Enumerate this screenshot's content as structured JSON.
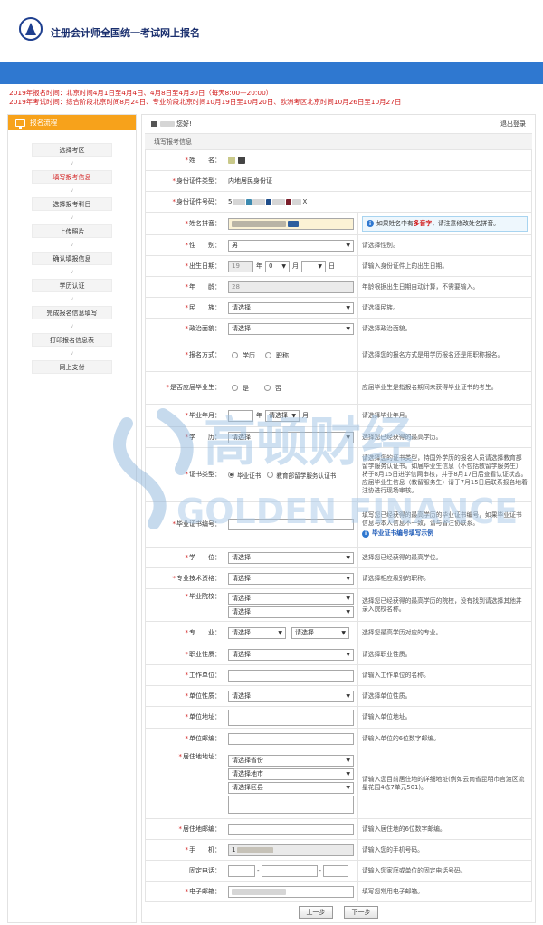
{
  "header": {
    "title": "注册会计师全国统一考试网上报名"
  },
  "notice": {
    "line1": "2019年报名时间：北京时间4月1日至4月4日、4月8日至4月30日（每天8:00—20:00）",
    "line2": "2019年考试时间：综合阶段北京时间8月24日、专业阶段北京时间10月19日至10月20日、欧洲考区北京时间10月26日至10月27日"
  },
  "sidebar": {
    "title": "报名流程",
    "steps": [
      {
        "label": "选择考区"
      },
      {
        "label": "填写报考信息"
      },
      {
        "label": "选择报考科目"
      },
      {
        "label": "上传照片"
      },
      {
        "label": "确认填报信息"
      },
      {
        "label": "学历认证"
      },
      {
        "label": "完成报名信息填写"
      },
      {
        "label": "打印报名信息表"
      },
      {
        "label": "网上支付"
      }
    ]
  },
  "main": {
    "greeting": "您好!",
    "logout": "退出登录",
    "section_title": "填写报考信息"
  },
  "form": {
    "name": {
      "label": "姓　　名："
    },
    "id_type": {
      "label": "身份证件类型：",
      "value": "内地居民身份证"
    },
    "id_number": {
      "label": "身份证件号码：",
      "prefix": "5",
      "suffix": "X"
    },
    "pinyin": {
      "label": "姓名拼音：",
      "hint_prefix": "如果姓名中有",
      "hint_red": "多音字",
      "hint_suffix": "，请注意修改姓名拼音。"
    },
    "gender": {
      "label": "性　　别：",
      "value": "男",
      "tip": "请选择性别。"
    },
    "birth": {
      "label": "出生日期：",
      "year_prefix": "19",
      "year_unit": "年",
      "month_value": "0",
      "month_unit": "月",
      "day_unit": "日",
      "tip": "请输入身份证件上的出生日期。"
    },
    "age": {
      "label": "年　　龄：",
      "value": "28",
      "tip": "年龄根据出生日期自动计算，不需要输入。"
    },
    "ethnic": {
      "label": "民　　族：",
      "value": "请选择",
      "tip": "请选择民族。"
    },
    "political": {
      "label": "政治面貌：",
      "value": "请选择",
      "tip": "请选择政治面貌。"
    },
    "apply_method": {
      "label": "报名方式：",
      "opt1": "学历",
      "opt2": "职称",
      "tip": "请选择您的报名方式是用学历报名还是用职称报名。"
    },
    "fresh_grad": {
      "label": "是否应届毕业生：",
      "opt1": "是",
      "opt2": "否",
      "tip": "应届毕业生是指报名期间未获得毕业证书的考生。"
    },
    "grad_year": {
      "label": "毕业年月：",
      "year_unit": "年",
      "month_value": "请选择",
      "month_unit": "月",
      "tip": "请选择毕业年月。"
    },
    "education": {
      "label": "学　　历：",
      "value": "请选择",
      "tip": "选择您已经获得的最高学历。"
    },
    "cert_type": {
      "label": "证书类型：",
      "opt1": "毕业证书",
      "opt2": "教育部留学服务认证书",
      "tip": "请选择您的证书类型，持国外学历的报名人员请选择教育部留学服务认证书。如届毕业生信息（不包括教留学服务生）将于8月15日进学信网审核，并于8月17日后查看认证状态。应届毕业生信息（教留服务生）请于7月15日后联系报名地着注协进行现场审核。"
    },
    "cert_no": {
      "label": "毕业证书编号：",
      "tip": "填写您已经获得的最高学历的毕业证书编号，如果毕业证书信息与本人信息不一致，请与省注协联系。",
      "link": "毕业证书编号填写示例"
    },
    "degree": {
      "label": "学　　位：",
      "value": "请选择",
      "tip": "选择您已经获得的最高学位。"
    },
    "title": {
      "label": "专业技术资格：",
      "value": "请选择",
      "tip": "请选择相应级别的职称。"
    },
    "school": {
      "label": "毕业院校：",
      "value1": "请选择",
      "value2": "请选择",
      "tip": "选择您已经获得的最高学历的院校，没有找到请选择其他并录入院校名称。"
    },
    "major": {
      "label": "专　　业：",
      "value1": "请选择",
      "value2": "请选择",
      "tip": "选择您最高学历对应的专业。"
    },
    "job_type": {
      "label": "职业性质：",
      "value": "请选择",
      "tip": "请选择职业性质。"
    },
    "employer": {
      "label": "工作单位：",
      "tip": "请输入工作单位的名称。"
    },
    "employer_type": {
      "label": "单位性质：",
      "value": "请选择",
      "tip": "请选择单位性质。"
    },
    "employer_addr": {
      "label": "单位地址：",
      "tip": "请输入单位地址。"
    },
    "employer_zip": {
      "label": "单位邮编：",
      "tip": "请输入单位的6位数字邮编。"
    },
    "home_addr": {
      "label": "居住地地址：",
      "province": "请选择省份",
      "city": "请选择地市",
      "county": "请选择区县",
      "tip": "请输入您目前居住地的详细地址(例如云南省昆明市官渡区流星花园4栋7单元501)。"
    },
    "home_zip": {
      "label": "居住地邮编：",
      "tip": "请输入居住地的6位数字邮编。"
    },
    "mobile": {
      "label": "手　　机：",
      "prefix": "1",
      "tip": "请输入您的手机号码。"
    },
    "phone": {
      "label": "固定电话：",
      "sep": "-",
      "tip": "请输入您家庭或单位的固定电话号码。"
    },
    "email": {
      "label": "电子邮箱：",
      "tip": "填写您常用电子邮箱。"
    }
  },
  "buttons": {
    "prev": "上一步",
    "next": "下一步"
  },
  "watermark": {
    "cn": "高顿财经",
    "en": "GOLDEN FINANCE"
  },
  "colors": {
    "accent": "#2f78d0",
    "orange": "#f7a21b",
    "red": "#d21c1c"
  }
}
